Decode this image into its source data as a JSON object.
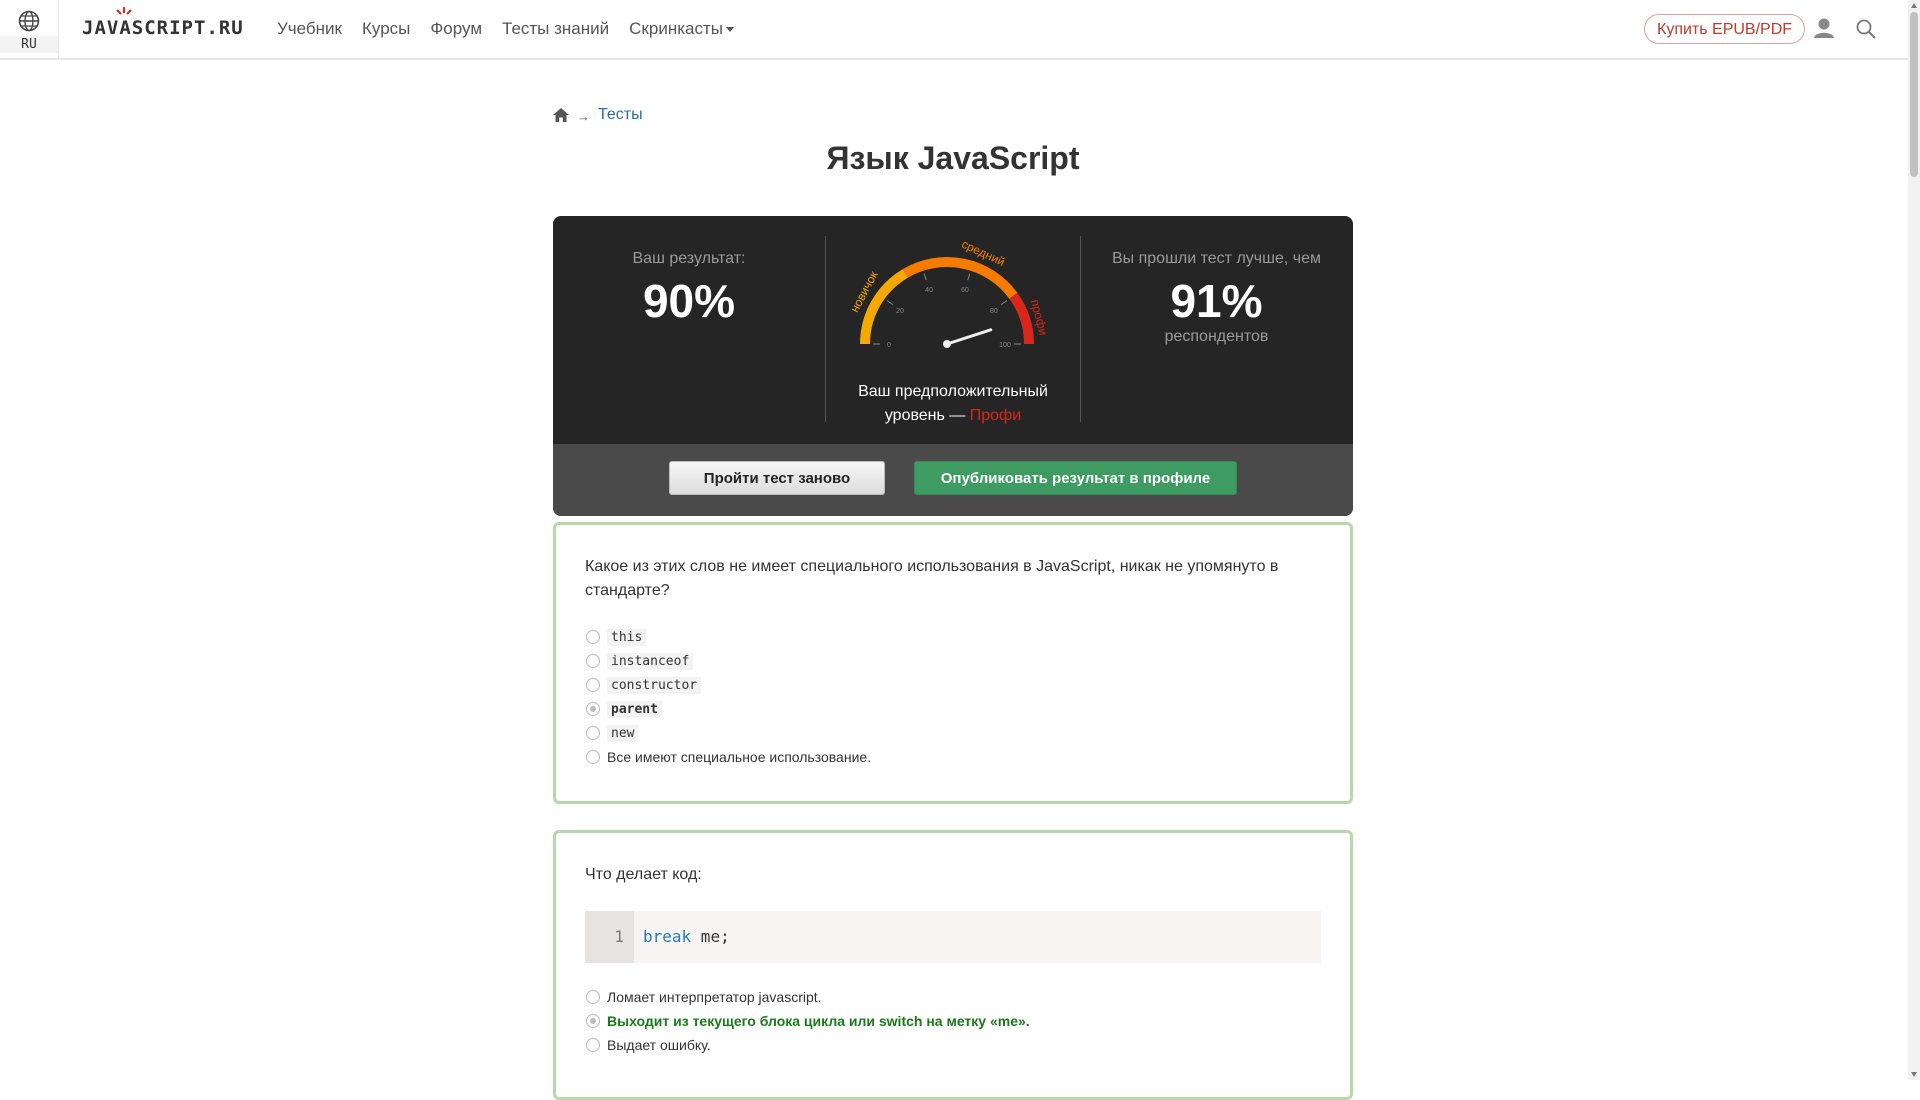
{
  "header": {
    "lang_code": "RU",
    "logo": "JAVASCRIPT.RU",
    "nav": [
      "Учебник",
      "Курсы",
      "Форум",
      "Тесты знаний",
      "Скринкасты"
    ],
    "buy_label": "Купить EPUB/PDF"
  },
  "breadcrumb": {
    "link": "Тесты",
    "arrow": "→"
  },
  "page_title": "Язык JavaScript",
  "result": {
    "your_result_label": "Ваш результат:",
    "your_result_value": "90%",
    "gauge": {
      "labels": [
        "новичок",
        "средний",
        "профи"
      ],
      "ticks": [
        "0",
        "20",
        "40",
        "60",
        "80",
        "100"
      ],
      "needle_value": 90,
      "colors": [
        "#f5a800",
        "#f57c00",
        "#d9261c"
      ]
    },
    "level_text_1": "Ваш предположительный",
    "level_text_2": "уровень — ",
    "level_value": "Профи",
    "better_than_label": "Вы прошли тест лучше, чем",
    "better_than_value": "91%",
    "respondents_label": "респондентов",
    "retry_label": "Пройти тест заново",
    "publish_label": "Опубликовать результат в профиле"
  },
  "questions": [
    {
      "text": "Какое из этих слов не имеет специального использования в JavaScript, никак не упомянуто в стандарте?",
      "options": [
        {
          "label": "this",
          "selected": false
        },
        {
          "label": "instanceof",
          "selected": false
        },
        {
          "label": "constructor",
          "selected": false
        },
        {
          "label": "parent",
          "selected": true
        },
        {
          "label": "new",
          "selected": false
        },
        {
          "label": "Все имеют специальное использование.",
          "selected": false
        }
      ]
    },
    {
      "text": "Что делает код:",
      "code_line_number": "1",
      "code_keyword": "break",
      "code_rest": " me;",
      "options": [
        {
          "label": "Ломает интерпретатор javascript.",
          "selected": false
        },
        {
          "label": "Выходит из текущего блока цикла или switch на метку «me».",
          "selected": true
        },
        {
          "label": "Выдает ошибку.",
          "selected": false
        }
      ]
    }
  ]
}
